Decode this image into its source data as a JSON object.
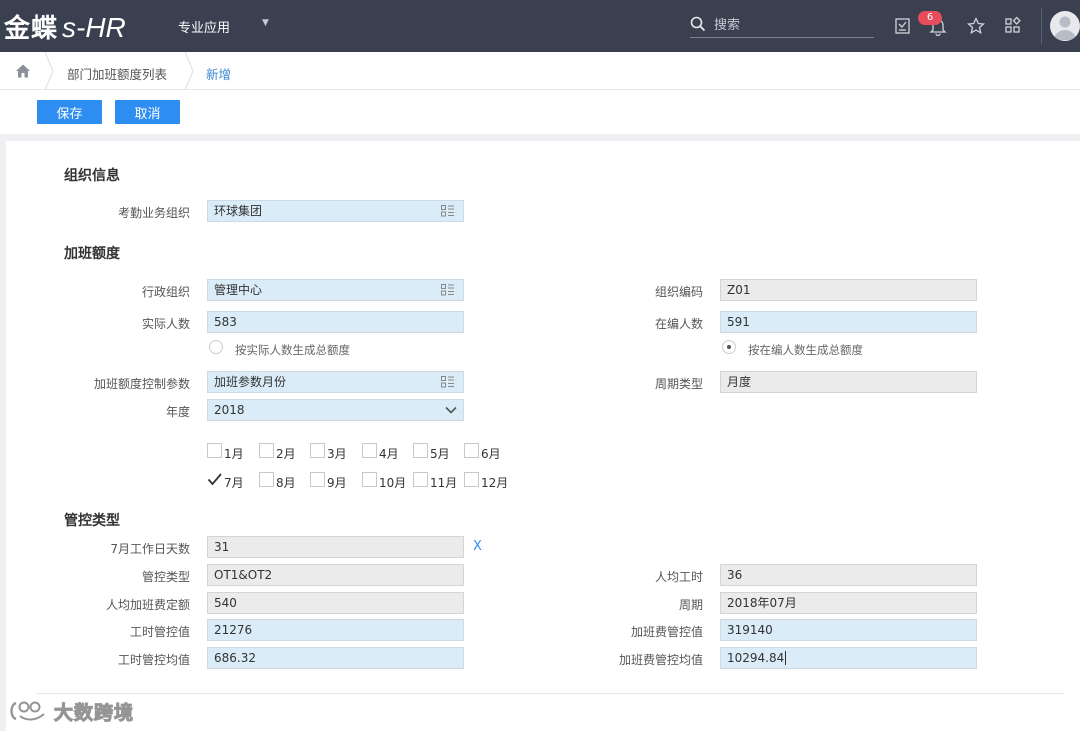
{
  "header": {
    "logo_cn": "金蝶",
    "logo_en": "s-HR",
    "app_menu": "专业应用",
    "search_placeholder": "搜索",
    "notification_count": "6"
  },
  "breadcrumb": {
    "list": "部门加班额度列表",
    "current": "新增"
  },
  "toolbar": {
    "save": "保存",
    "cancel": "取消"
  },
  "org_info": {
    "title": "组织信息",
    "attendance_org_label": "考勤业务组织",
    "attendance_org_value": "环球集团"
  },
  "ot_quota": {
    "title": "加班额度",
    "admin_org_label": "行政组织",
    "admin_org_value": "管理中心",
    "org_code_label": "组织编码",
    "org_code_value": "Z01",
    "actual_count_label": "实际人数",
    "actual_count_value": "583",
    "staff_count_label": "在编人数",
    "staff_count_value": "591",
    "radio_actual": "按实际人数生成总额度",
    "radio_staff": "按在编人数生成总额度",
    "radio_selected": "staff",
    "control_param_label": "加班额度控制参数",
    "control_param_value": "加班参数月份",
    "period_type_label": "周期类型",
    "period_type_value": "月度",
    "year_label": "年度",
    "year_value": "2018",
    "months": [
      {
        "label": "1月",
        "checked": false
      },
      {
        "label": "2月",
        "checked": false
      },
      {
        "label": "3月",
        "checked": false
      },
      {
        "label": "4月",
        "checked": false
      },
      {
        "label": "5月",
        "checked": false
      },
      {
        "label": "6月",
        "checked": false
      },
      {
        "label": "7月",
        "checked": true
      },
      {
        "label": "8月",
        "checked": false
      },
      {
        "label": "9月",
        "checked": false
      },
      {
        "label": "10月",
        "checked": false
      },
      {
        "label": "11月",
        "checked": false
      },
      {
        "label": "12月",
        "checked": false
      }
    ]
  },
  "control": {
    "title": "管控类型",
    "workdays_label": "7月工作日天数",
    "workdays_value": "31",
    "clear_mark": "X",
    "control_type_label": "管控类型",
    "control_type_value": "OT1&OT2",
    "avg_hours_label": "人均工时",
    "avg_hours_value": "36",
    "avg_fee_quota_label": "人均加班费定额",
    "avg_fee_quota_value": "540",
    "period_label": "周期",
    "period_value": "2018年07月",
    "hours_control_label": "工时管控值",
    "hours_control_value": "21276",
    "fee_control_label": "加班费管控值",
    "fee_control_value": "319140",
    "hours_avg_label": "工时管控均值",
    "hours_avg_value": "686.32",
    "fee_avg_label": "加班费管控均值",
    "fee_avg_value": "10294.84"
  },
  "watermark": "大数跨境"
}
